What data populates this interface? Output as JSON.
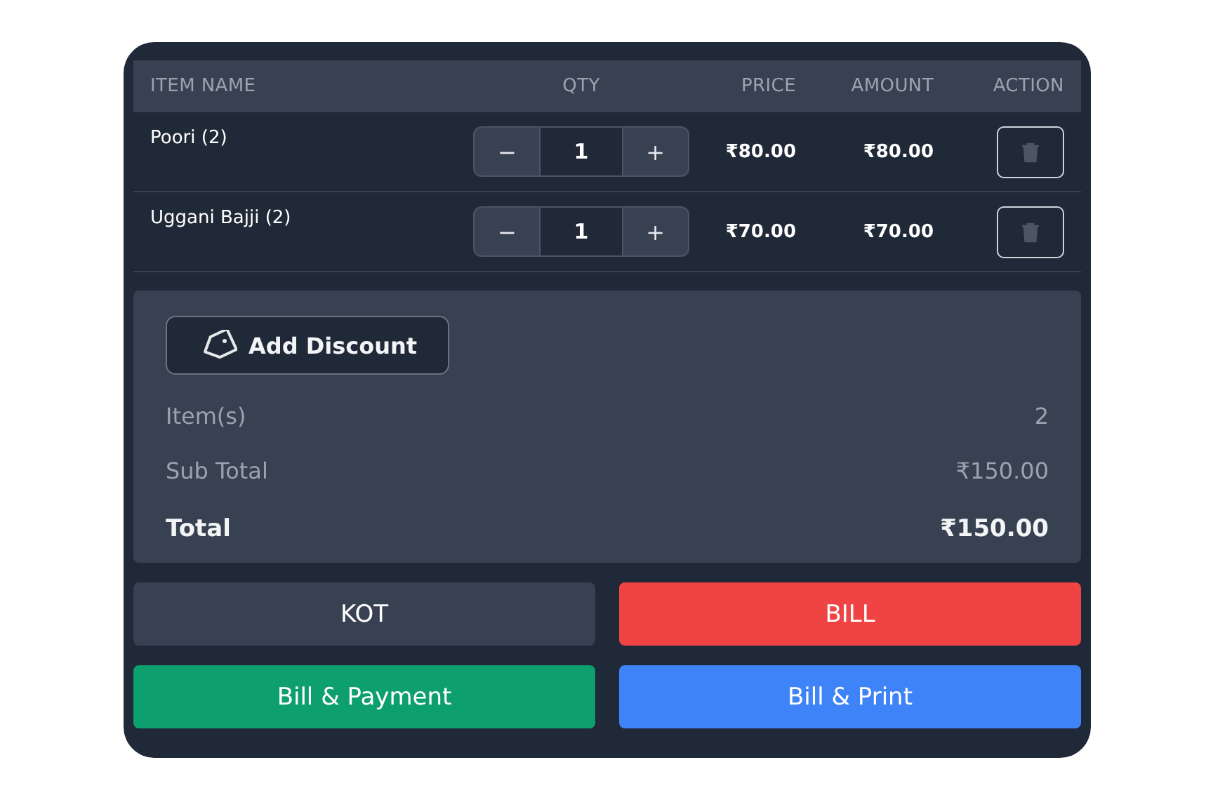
{
  "table": {
    "columns": [
      "ITEM NAME",
      "QTY",
      "PRICE",
      "AMOUNT",
      "ACTION"
    ],
    "rows": [
      {
        "name": "Poori (2)",
        "minus": "−",
        "qty": "1",
        "plus": "+",
        "price": "₹80.00",
        "amount": "₹80.00"
      },
      {
        "name": "Uggani Bajji (2)",
        "minus": "−",
        "qty": "1",
        "plus": "+",
        "price": "₹70.00",
        "amount": "₹70.00"
      }
    ]
  },
  "summary": {
    "discount_button": "Add Discount",
    "lines": [
      {
        "label": "Item(s)",
        "value": "2",
        "kind": "normal"
      },
      {
        "label": "Sub Total",
        "value": "₹150.00",
        "kind": "normal"
      },
      {
        "label": "Total",
        "value": "₹150.00",
        "kind": "total"
      }
    ]
  },
  "buttons": [
    {
      "label": "KOT",
      "color": "#374151"
    },
    {
      "label": "BILL",
      "color": "#f04444"
    },
    {
      "label": "Bill & Payment",
      "color": "#0e9f6e"
    },
    {
      "label": "Bill & Print",
      "color": "#3f83f8"
    }
  ]
}
